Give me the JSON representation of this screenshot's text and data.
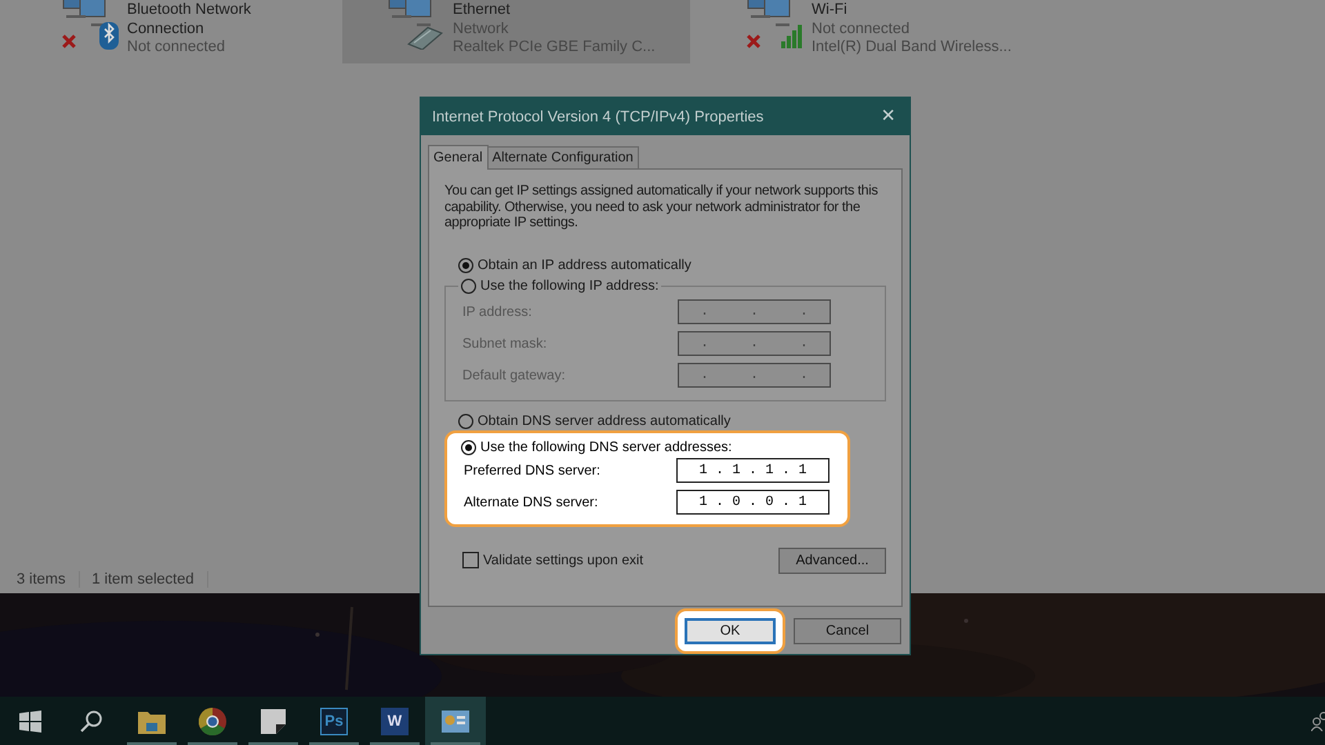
{
  "explorer": {
    "connections": [
      {
        "kind": "bluetooth",
        "name": "Bluetooth Network Connection",
        "status": "Not connected",
        "disconnected": true,
        "selected": false
      },
      {
        "kind": "ethernet",
        "name": "Ethernet",
        "status": "Network",
        "adapter": "Realtek PCIe GBE Family C...",
        "disconnected": false,
        "selected": true
      },
      {
        "kind": "wifi",
        "name": "Wi-Fi",
        "status": "Not connected",
        "adapter": "Intel(R) Dual Band Wireless...",
        "disconnected": true,
        "selected": false
      }
    ],
    "status_bar": [
      "3 items",
      "1 item selected"
    ]
  },
  "dialog": {
    "title": "Internet Protocol Version 4 (TCP/IPv4) Properties",
    "close": "✕",
    "tabs": [
      {
        "label": "General",
        "selected": true
      },
      {
        "label": "Alternate Configuration",
        "selected": false
      }
    ],
    "description": "You can get IP settings assigned automatically if your network supports this capability. Otherwise, you need to ask your network administrator for the appropriate IP settings.",
    "ip_modes": [
      {
        "label": "Obtain an IP address automatically",
        "selected": true
      },
      {
        "label": "Use the following IP address:",
        "selected": false
      }
    ],
    "ip_fields": [
      {
        "label": "IP address:",
        "value": ".     .     .",
        "disabled": true
      },
      {
        "label": "Subnet mask:",
        "value": ".     .     .",
        "disabled": true
      },
      {
        "label": "Default gateway:",
        "value": ".     .     .",
        "disabled": true
      }
    ],
    "dns_modes": [
      {
        "label": "Obtain DNS server address automatically",
        "selected": false
      },
      {
        "label": "Use the following DNS server addresses:",
        "selected": true
      }
    ],
    "dns_highlighted": true,
    "dns_fields": [
      {
        "label": "Preferred DNS server:",
        "value": "1 . 1 . 1 . 1",
        "disabled": false
      },
      {
        "label": "Alternate DNS server:",
        "value": "1 . 0 . 0 . 1",
        "disabled": false
      }
    ],
    "validate": {
      "label": "Validate settings upon exit",
      "checked": false
    },
    "advanced": "Advanced...",
    "buttons": [
      {
        "label": "OK",
        "highlighted": true
      },
      {
        "label": "Cancel",
        "highlighted": false
      }
    ]
  },
  "taskbar": {
    "apps": [
      {
        "kind": "start",
        "running": false,
        "active": false
      },
      {
        "kind": "search",
        "running": false,
        "active": false
      },
      {
        "kind": "folder",
        "running": true,
        "active": false
      },
      {
        "kind": "chrome",
        "running": true,
        "active": false
      },
      {
        "kind": "notes",
        "running": true,
        "active": false
      },
      {
        "kind": "photoshop",
        "label": "Ps",
        "running": true,
        "active": false
      },
      {
        "kind": "word",
        "label": "W",
        "running": true,
        "active": false
      },
      {
        "kind": "network",
        "running": true,
        "active": true
      }
    ]
  }
}
